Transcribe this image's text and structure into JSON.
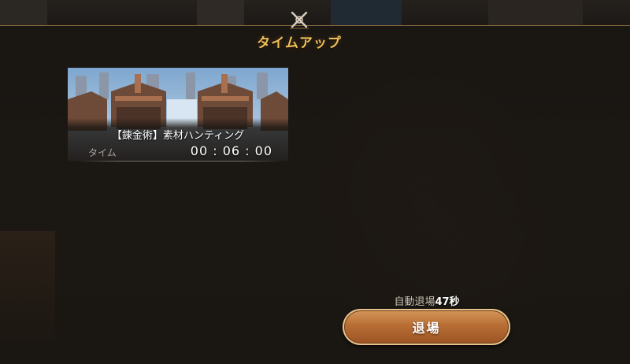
{
  "header": {
    "title": "タイムアップ",
    "emblem_icon": "crossed-swords-icon"
  },
  "result_card": {
    "quest_name": "【錬金術】素材ハンティング",
    "time_label": "タイム",
    "time_value": "00 : 06 : 00"
  },
  "auto_exit": {
    "prefix": "自動退場",
    "seconds": "47",
    "suffix": "秒"
  },
  "exit_button": {
    "label": "退場"
  },
  "colors": {
    "title": "#f0c15a",
    "button": "#b86e34",
    "panel_border": "#8a6a3e"
  }
}
